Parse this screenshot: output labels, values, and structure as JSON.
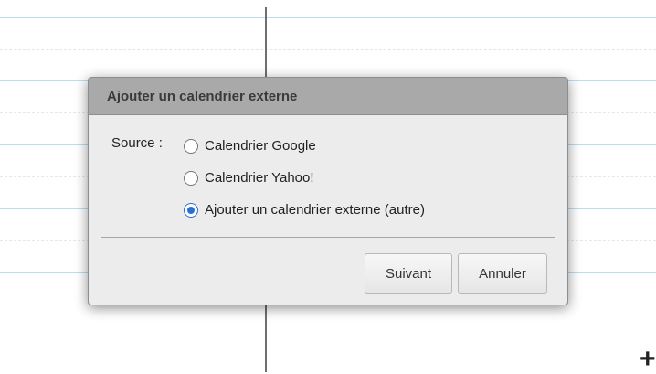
{
  "dialog": {
    "title": "Ajouter un calendrier externe",
    "source_label": "Source :",
    "options": [
      {
        "label": "Calendrier Google",
        "selected": false
      },
      {
        "label": "Calendrier Yahoo!",
        "selected": false
      },
      {
        "label": "Ajouter un calendrier externe (autre)",
        "selected": true
      }
    ],
    "next_label": "Suivant",
    "cancel_label": "Annuler"
  },
  "cursor": "+",
  "colors": {
    "header_bg": "#a9a9a9",
    "dialog_bg": "#ececec",
    "radio_selected": "#2a6fd6",
    "grid_line": "#bcdcf2"
  }
}
